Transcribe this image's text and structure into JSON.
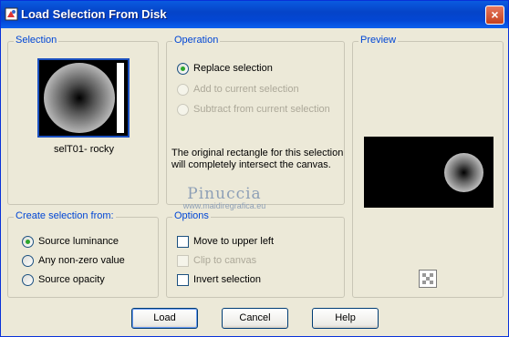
{
  "window": {
    "title": "Load Selection From Disk",
    "close_label": "×"
  },
  "selection_group": {
    "label": "Selection",
    "file_name": "selT01- rocky"
  },
  "operation_group": {
    "label": "Operation",
    "options": [
      {
        "label": "Replace selection",
        "selected": true,
        "enabled": true
      },
      {
        "label": "Add to current selection",
        "selected": false,
        "enabled": false
      },
      {
        "label": "Subtract from current selection",
        "selected": false,
        "enabled": false
      }
    ],
    "message_line1": "The original rectangle for this selection",
    "message_line2": "will completely intersect the canvas."
  },
  "preview_group": {
    "label": "Preview"
  },
  "create_group": {
    "label": "Create selection from:",
    "options": [
      {
        "label": "Source luminance",
        "selected": true
      },
      {
        "label": "Any non-zero value",
        "selected": false
      },
      {
        "label": "Source opacity",
        "selected": false
      }
    ]
  },
  "options_group": {
    "label": "Options",
    "items": [
      {
        "label": "Move to upper left",
        "checked": false,
        "enabled": true
      },
      {
        "label": "Clip to canvas",
        "checked": false,
        "enabled": false
      },
      {
        "label": "Invert selection",
        "checked": false,
        "enabled": true
      }
    ]
  },
  "watermark": {
    "name": "Pinuccia",
    "url": "www.maidiregrafica.eu"
  },
  "buttons": {
    "load": "Load",
    "cancel": "Cancel",
    "help": "Help"
  }
}
